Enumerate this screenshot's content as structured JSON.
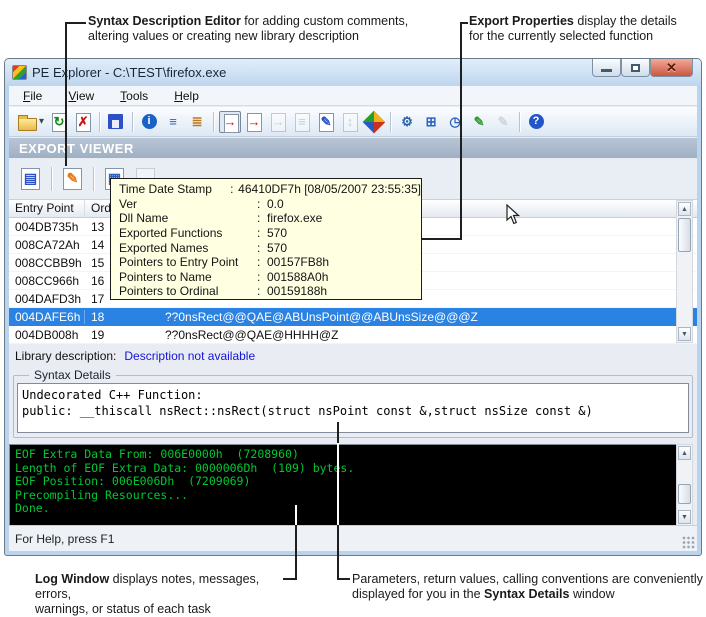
{
  "annotations": {
    "top_left": {
      "line1_bold": "Syntax Description Editor",
      "line1_rest": " for adding custom comments,",
      "line2": "altering values or creating new library description"
    },
    "top_right": {
      "line1_bold": "Export Properties",
      "line1_rest": " display the details",
      "line2": "for the currently selected function"
    },
    "bottom_left": {
      "line1_bold": "Log Window",
      "line1_rest": " displays notes, messages, errors,",
      "line2": "warnings, or status of each task"
    },
    "bottom_right": {
      "line1": "Parameters, return values, calling conventions are conveniently",
      "line2_pre": "displayed for you in the ",
      "line2_bold": "Syntax Details",
      "line2_post": " window"
    }
  },
  "window": {
    "title": "PE Explorer - C:\\TEST\\firefox.exe",
    "banner": "EXPORT VIEWER",
    "status": "For Help, press F1"
  },
  "menu": {
    "items": [
      {
        "label": "File"
      },
      {
        "label": "View"
      },
      {
        "label": "Tools"
      },
      {
        "label": "Help"
      }
    ]
  },
  "toolbar": {
    "buttons": [
      {
        "kind": "folder",
        "name": "open-file-button"
      },
      {
        "kind": "caret",
        "name": "open-file-dropdown",
        "ch": "▾"
      },
      {
        "kind": "doc",
        "name": "reload-file-button",
        "ch": "↻",
        "color": "#128812"
      },
      {
        "kind": "doc",
        "name": "close-file-button",
        "ch": "✗",
        "color": "#cc1111"
      },
      {
        "kind": "sep"
      },
      {
        "kind": "floppy",
        "name": "save-button"
      },
      {
        "kind": "sep"
      },
      {
        "kind": "circle",
        "name": "headers-info-button",
        "ch": "i",
        "color": "#ffffff",
        "bg": "#1b62c8"
      },
      {
        "kind": "plain",
        "name": "section-headers-button",
        "ch": "≡",
        "color": "#2a62c0"
      },
      {
        "kind": "plain",
        "name": "data-directories-button",
        "ch": "≣",
        "color": "#c07818"
      },
      {
        "kind": "sep"
      },
      {
        "kind": "doc",
        "name": "export-viewer-button",
        "ch": "→",
        "color": "#d01010",
        "active": true
      },
      {
        "kind": "doc",
        "name": "import-viewer-button",
        "ch": "→",
        "color": "#d01010"
      },
      {
        "kind": "doc",
        "name": "delay-import-viewer-button",
        "ch": "→",
        "color": "#9aa4ae",
        "disabled": true
      },
      {
        "kind": "doc",
        "name": "exception-viewer-button",
        "ch": "≡",
        "color": "#9aa4ae",
        "disabled": true
      },
      {
        "kind": "doc",
        "name": "debug-info-viewer-button",
        "ch": "✎",
        "color": "#2a52c0"
      },
      {
        "kind": "doc",
        "name": "relocation-viewer-button",
        "ch": "↕",
        "color": "#9aa4ae",
        "disabled": true
      },
      {
        "kind": "diamond",
        "name": "resource-viewer-button"
      },
      {
        "kind": "sep"
      },
      {
        "kind": "plain",
        "name": "disassembler-button",
        "ch": "⚙",
        "color": "#2a62a8"
      },
      {
        "kind": "plain",
        "name": "dependency-scanner-button",
        "ch": "⊞",
        "color": "#2a62c0"
      },
      {
        "kind": "plain",
        "name": "time-date-stamp-button",
        "ch": "◷",
        "color": "#2a62c0"
      },
      {
        "kind": "plain",
        "name": "resource-tools-button",
        "ch": "✎",
        "color": "#28a028"
      },
      {
        "kind": "plain",
        "name": "unbind-button",
        "ch": "✎",
        "color": "#aab2ba",
        "disabled": true
      },
      {
        "kind": "sep"
      },
      {
        "kind": "circle",
        "name": "help-button",
        "ch": "?",
        "color": "#ffffff",
        "bg": "#2255cc"
      }
    ]
  },
  "export_toolbar": {
    "buttons": [
      {
        "ch": "▤",
        "color": "#2b50c8"
      },
      {
        "ch": "✎",
        "color": "#e07820"
      },
      {
        "ch": "▦",
        "color": "#2a62c0"
      },
      {
        "ch": "",
        "color": "#9aa4ae"
      }
    ]
  },
  "tooltip": {
    "separator": ":",
    "rows": [
      {
        "label": "Time Date Stamp",
        "value": "46410DF7h  [08/05/2007  23:55:35]"
      },
      {
        "label": "Ver",
        "value": "0.0"
      },
      {
        "label": "Dll Name",
        "value": "firefox.exe"
      },
      {
        "label": "Exported Functions",
        "value": "570"
      },
      {
        "label": "Exported Names",
        "value": "570"
      },
      {
        "label": "Pointers to Entry Point",
        "value": "00157FB8h"
      },
      {
        "label": "Pointers to Name",
        "value": "001588A0h"
      },
      {
        "label": "Pointers to Ordinal",
        "value": "00159188h"
      }
    ]
  },
  "table": {
    "headers": {
      "entry": "Entry Point",
      "ord": "Ord",
      "name": ""
    },
    "rows": [
      {
        "entry": "004DB735h",
        "ord": "13",
        "name": ""
      },
      {
        "entry": "008CA72Ah",
        "ord": "14",
        "name": ""
      },
      {
        "entry": "008CCBB9h",
        "ord": "15",
        "name": ""
      },
      {
        "entry": "008CC966h",
        "ord": "16",
        "name": ""
      },
      {
        "entry": "004DAFD3h",
        "ord": "17",
        "name": ""
      },
      {
        "entry": "004DAFE6h",
        "ord": "18",
        "name": "??0nsRect@@QAE@ABUnsPoint@@ABUnsSize@@@Z"
      },
      {
        "entry": "004DB008h",
        "ord": "19",
        "name": "??0nsRect@@QAE@HHHH@Z"
      }
    ]
  },
  "library": {
    "label": "Library description:",
    "value": "Description not available"
  },
  "syntax": {
    "legend": "Syntax Details",
    "lines": [
      "Undecorated C++ Function:",
      "public: __thiscall nsRect::nsRect(struct nsPoint const &,struct nsSize const &)"
    ]
  },
  "log": {
    "lines": [
      "EOF Extra Data From: 006E0000h  (7208960)",
      "Length of EOF Extra Data: 0000006Dh  (109) bytes.",
      "EOF Position: 006E006Dh  (7209069)",
      "Precompiling Resources...",
      "Done."
    ]
  }
}
